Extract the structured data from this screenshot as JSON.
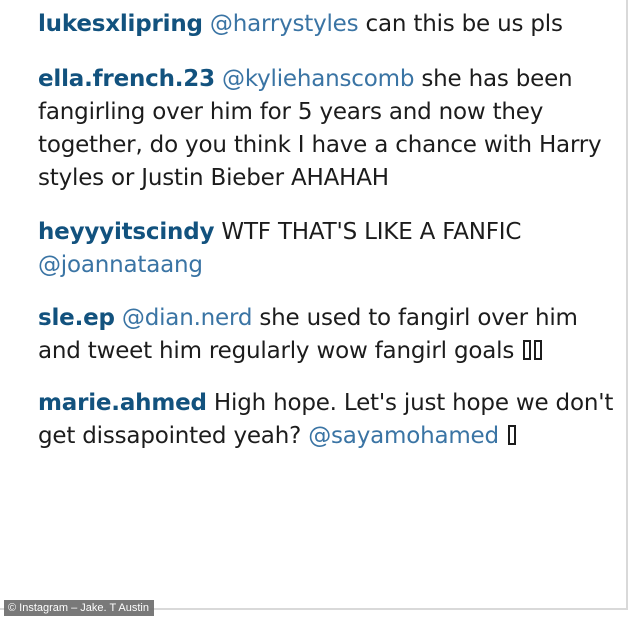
{
  "comments": [
    {
      "username": "lukesxlipring",
      "mention_before": "@harrystyles",
      "text": "can this be us pls",
      "emoji": []
    },
    {
      "username": "ella.french.23",
      "mention_before": "@kyliehanscomb",
      "text": "she has been fangirling over him for 5 years and now they together, do you think I have a chance with Harry styles or Justin Bieber AHAHAH",
      "emoji": []
    },
    {
      "username": "heyyyitscindy",
      "text": "WTF THAT'S LIKE A FANFIC",
      "mention_after": "@joannataang",
      "emoji": []
    },
    {
      "username": "sle.ep",
      "mention_before": "@dian.nerd",
      "text": "she used to fangirl over him and tweet him regularly wow fangirl goals",
      "emoji": [
        "missing-glyph-icon",
        "missing-glyph-icon"
      ]
    },
    {
      "username": "marie.ahmed",
      "text": "High hope. Let's just hope we don't get dissapointed yeah?",
      "mention_after": "@sayamohamed",
      "emoji": [
        "missing-glyph-icon"
      ]
    }
  ],
  "credit": "© Instagram – Jake. T Austin",
  "colors": {
    "username": "#12527e",
    "mention": "#3a74a4",
    "text": "#1c1c1c",
    "credit_bg": "#6e6e6e"
  }
}
